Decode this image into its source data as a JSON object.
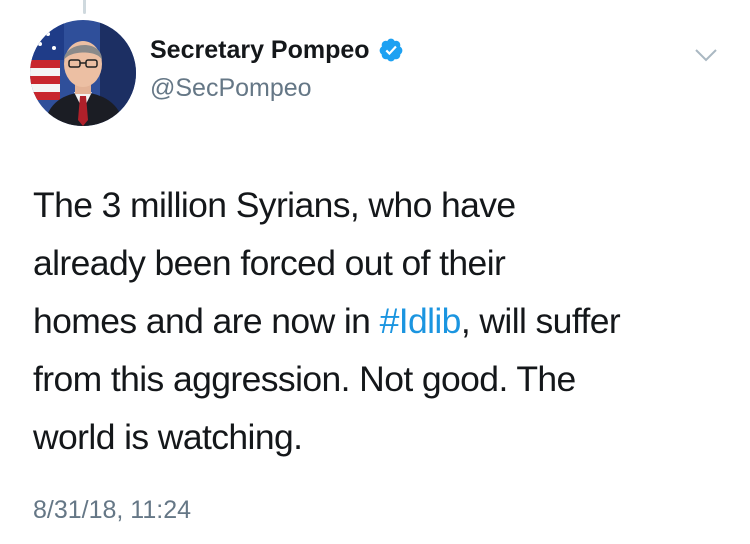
{
  "tweet": {
    "author": {
      "display_name": "Secretary Pompeo",
      "handle": "@SecPompeo",
      "verified": true
    },
    "text_segments": [
      "The 3 million Syrians, who have",
      "already been forced out of their",
      "homes and are now in ",
      "#Idlib",
      ", will suffer",
      "from this aggression. Not good. The",
      "world is watching."
    ],
    "timestamp": "8/31/18, 11:24"
  },
  "colors": {
    "text": "#14171a",
    "secondary_text": "#657786",
    "link": "#1b95e0",
    "verified_badge": "#1da1f2"
  },
  "icons": {
    "verified": "verified-badge-icon",
    "menu": "chevron-down-icon"
  }
}
